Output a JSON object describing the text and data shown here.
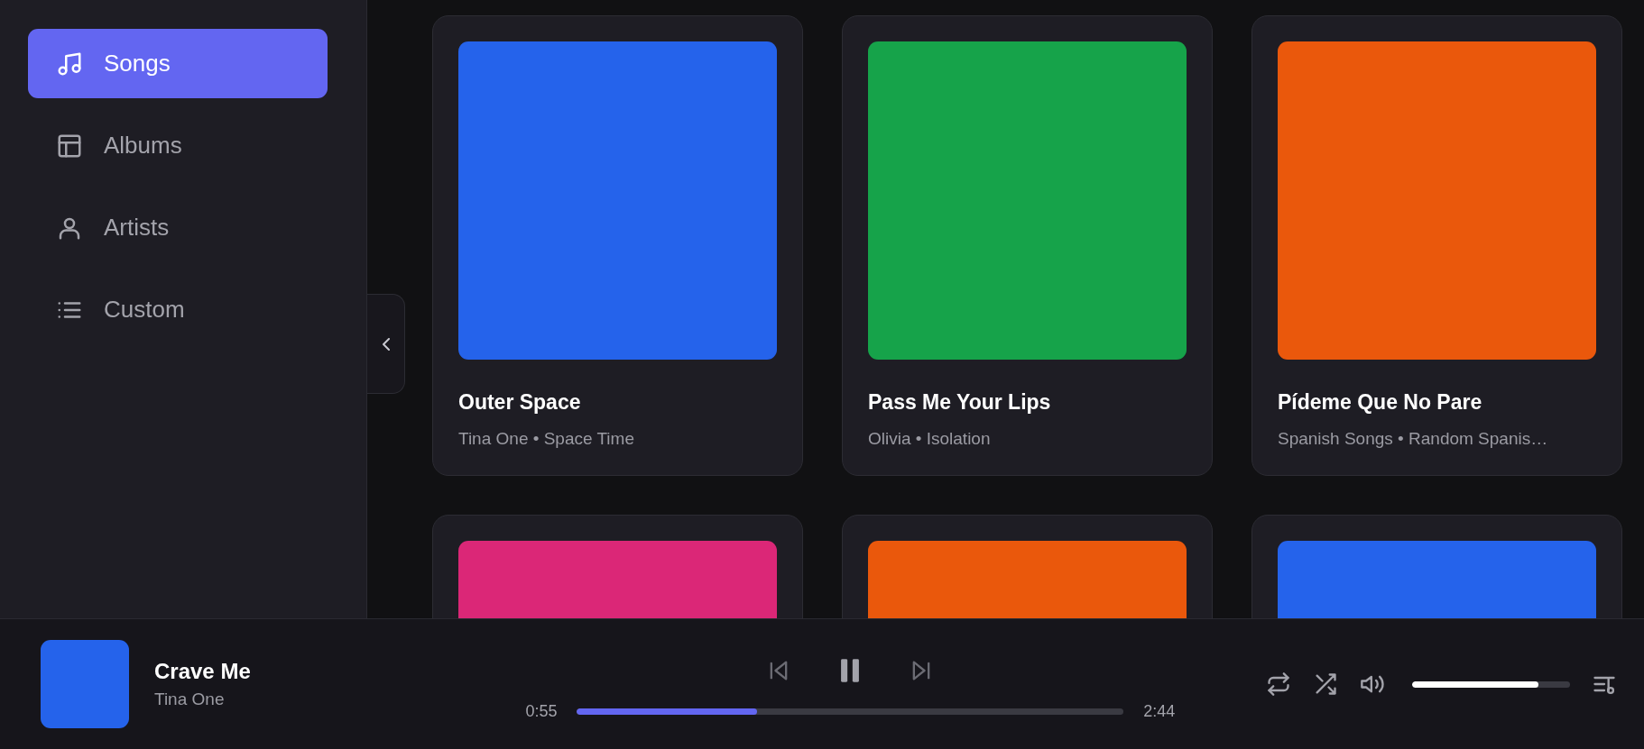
{
  "sidebar": {
    "items": [
      {
        "label": "Songs",
        "kind": "songs",
        "selected": true
      },
      {
        "label": "Albums",
        "kind": "albums",
        "selected": false
      },
      {
        "label": "Artists",
        "kind": "artists",
        "selected": false
      },
      {
        "label": "Custom",
        "kind": "custom",
        "selected": false
      }
    ]
  },
  "cards": [
    {
      "title": "Outer Space",
      "subtitle": "Tina One • Space Time",
      "color": "#2563eb"
    },
    {
      "title": "Pass Me Your Lips",
      "subtitle": "Olivia • Isolation",
      "color": "#16a34a"
    },
    {
      "title": "Pídeme Que No Pare",
      "subtitle": "Spanish Songs • Random Spanis…",
      "color": "#ea580c"
    },
    {
      "color": "#db2777"
    },
    {
      "color": "#ea580c"
    },
    {
      "color": "#2563eb"
    }
  ],
  "player": {
    "title": "Crave Me",
    "artist": "Tina One",
    "playing": true,
    "elapsed": "0:55",
    "duration": "2:44",
    "progress": {
      "level": 0.33
    },
    "volume": {
      "level": 0.8
    }
  }
}
